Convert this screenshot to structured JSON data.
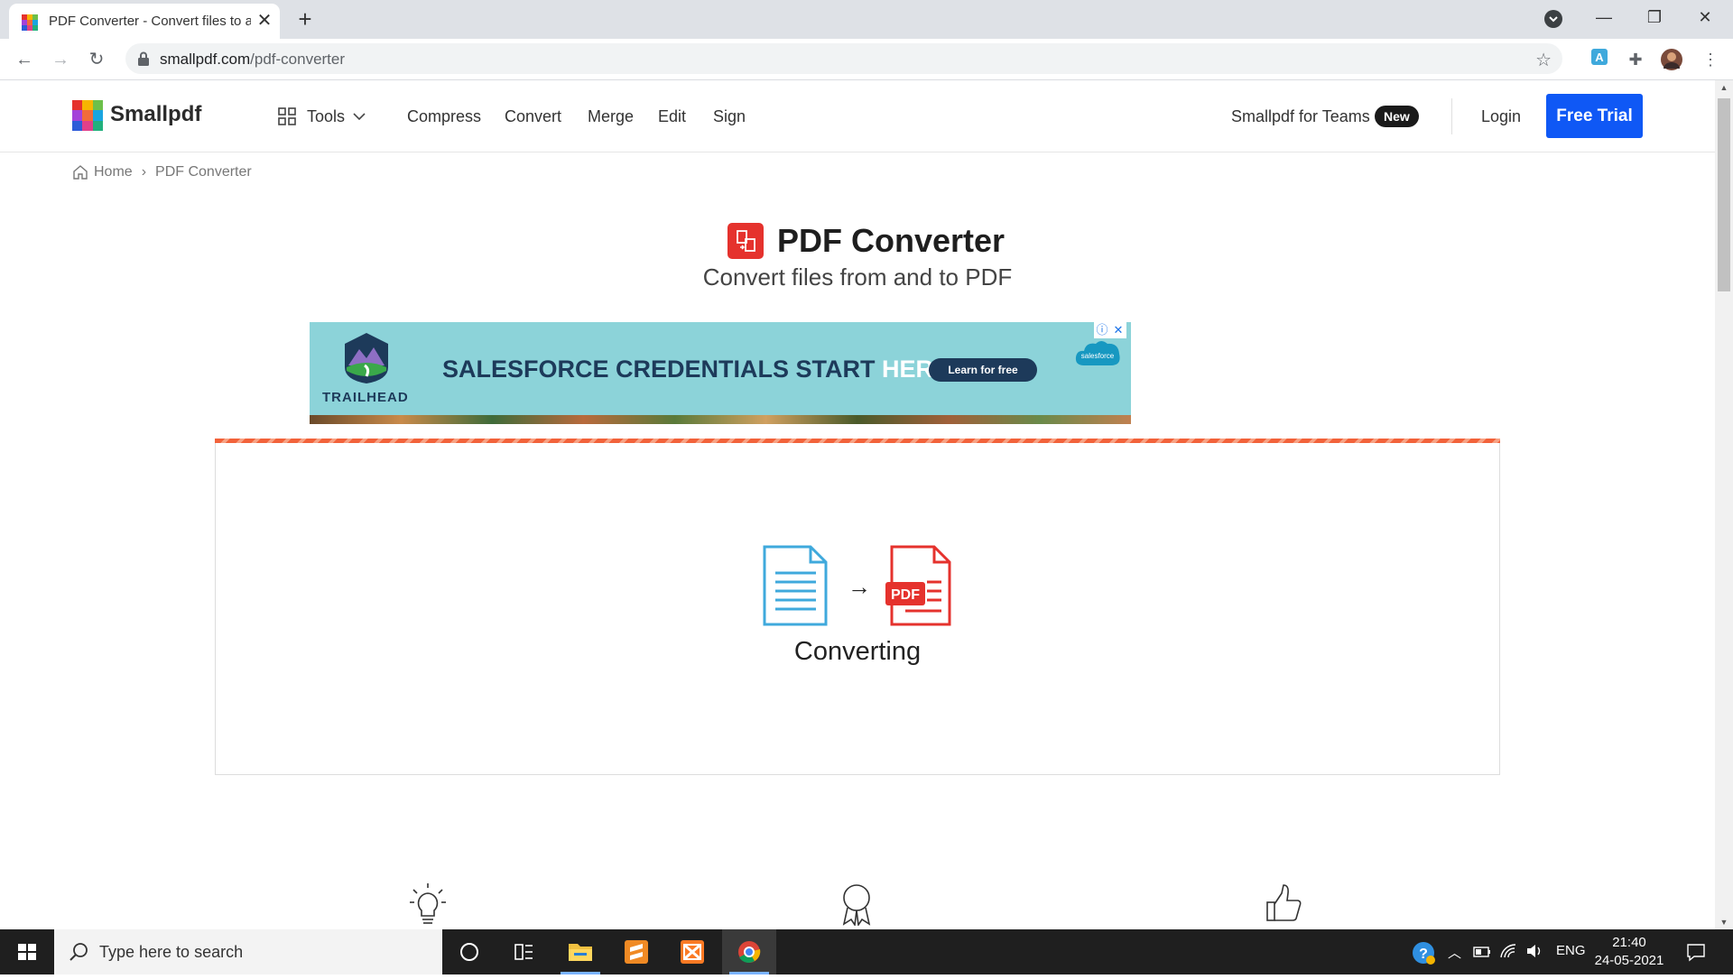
{
  "browser": {
    "tab_title": "PDF Converter - Convert files to a",
    "tab_close": "✕",
    "new_tab": "+",
    "url_host": "smallpdf.com",
    "url_path": "/pdf-converter",
    "window_controls": [
      "—",
      "❐",
      "✕"
    ]
  },
  "site": {
    "brand": "Smallpdf",
    "nav": {
      "tools": "Tools",
      "compress": "Compress",
      "convert": "Convert",
      "merge": "Merge",
      "edit": "Edit",
      "sign": "Sign"
    },
    "teams": "Smallpdf for Teams",
    "teams_badge": "New",
    "login": "Login",
    "free_trial": "Free Trial"
  },
  "breadcrumb": {
    "home": "Home",
    "separator": "›",
    "current": "PDF Converter"
  },
  "page": {
    "title": "PDF Converter",
    "subtitle": "Convert files from and to PDF"
  },
  "ad": {
    "brand": "TRAILHEAD",
    "headline_main": "SALESFORCE CREDENTIALS START ",
    "headline_highlight": "HERE.",
    "cta": "Learn for free",
    "sponsor": "salesforce",
    "info": "ⓘ",
    "close": "✕"
  },
  "converter": {
    "status": "Converting",
    "pdf_label": "PDF",
    "arrow": "→"
  },
  "taskbar": {
    "search_placeholder": "Type here to search",
    "language": "ENG",
    "time": "21:40",
    "date": "24-05-2021"
  },
  "colors": {
    "accent_blue": "#0f58f5",
    "pdf_red": "#e5322d",
    "ad_bg": "#8cd3d9",
    "doc_blue": "#3fa9dc"
  }
}
